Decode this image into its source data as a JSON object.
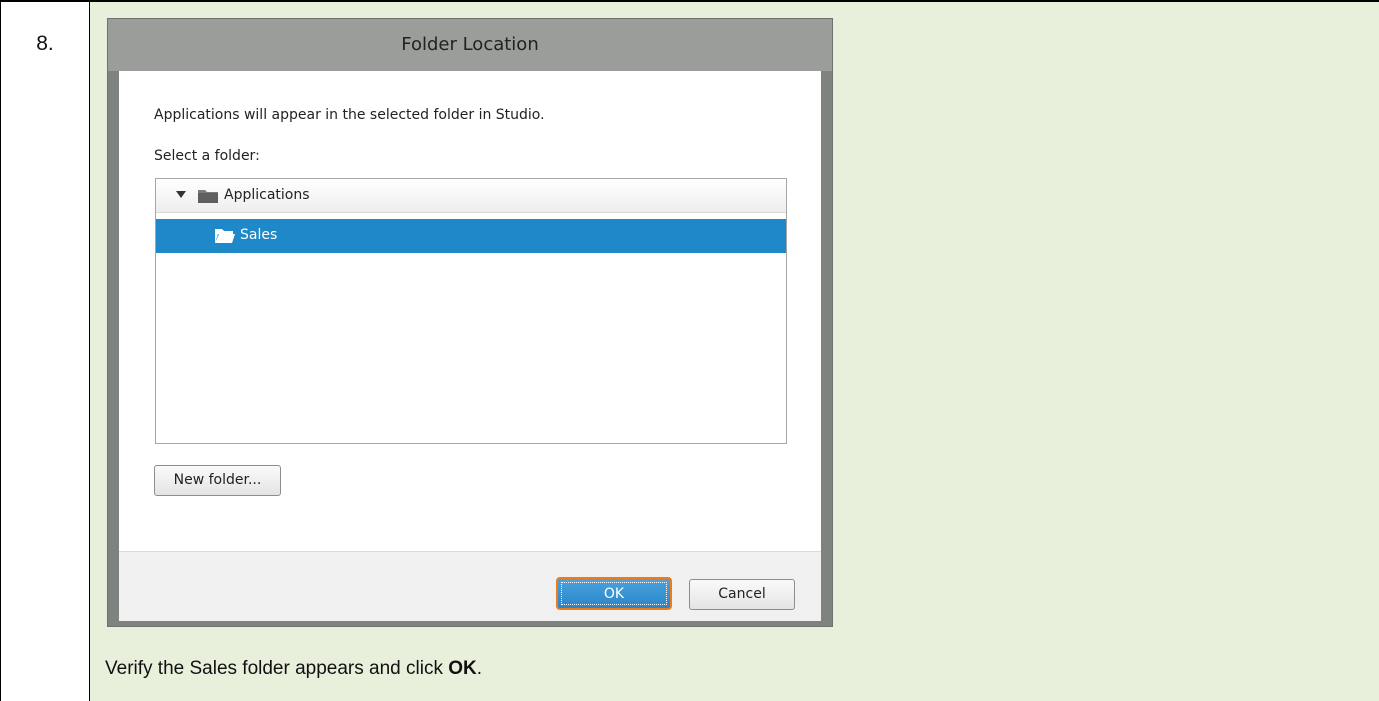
{
  "step": {
    "number": "8."
  },
  "dialog": {
    "title": "Folder Location",
    "description": "Applications will appear in the selected folder in Studio.",
    "select_label": "Select a folder:",
    "tree": [
      {
        "label": "Applications",
        "icon": "folder-icon",
        "expanded": true,
        "selected": false
      },
      {
        "label": "Sales",
        "icon": "folder-open-icon",
        "expanded": false,
        "selected": true
      }
    ],
    "new_folder_label": "New folder...",
    "ok_label": "OK",
    "cancel_label": "Cancel"
  },
  "instruction": {
    "prefix": "Verify the Sales folder appears and click ",
    "bold": "OK",
    "suffix": "."
  },
  "colors": {
    "content_background": "#e8f0dc",
    "selection": "#1e88c8",
    "ok_focus_border": "#ef7a1a",
    "dialog_frame": "#7f837f"
  }
}
